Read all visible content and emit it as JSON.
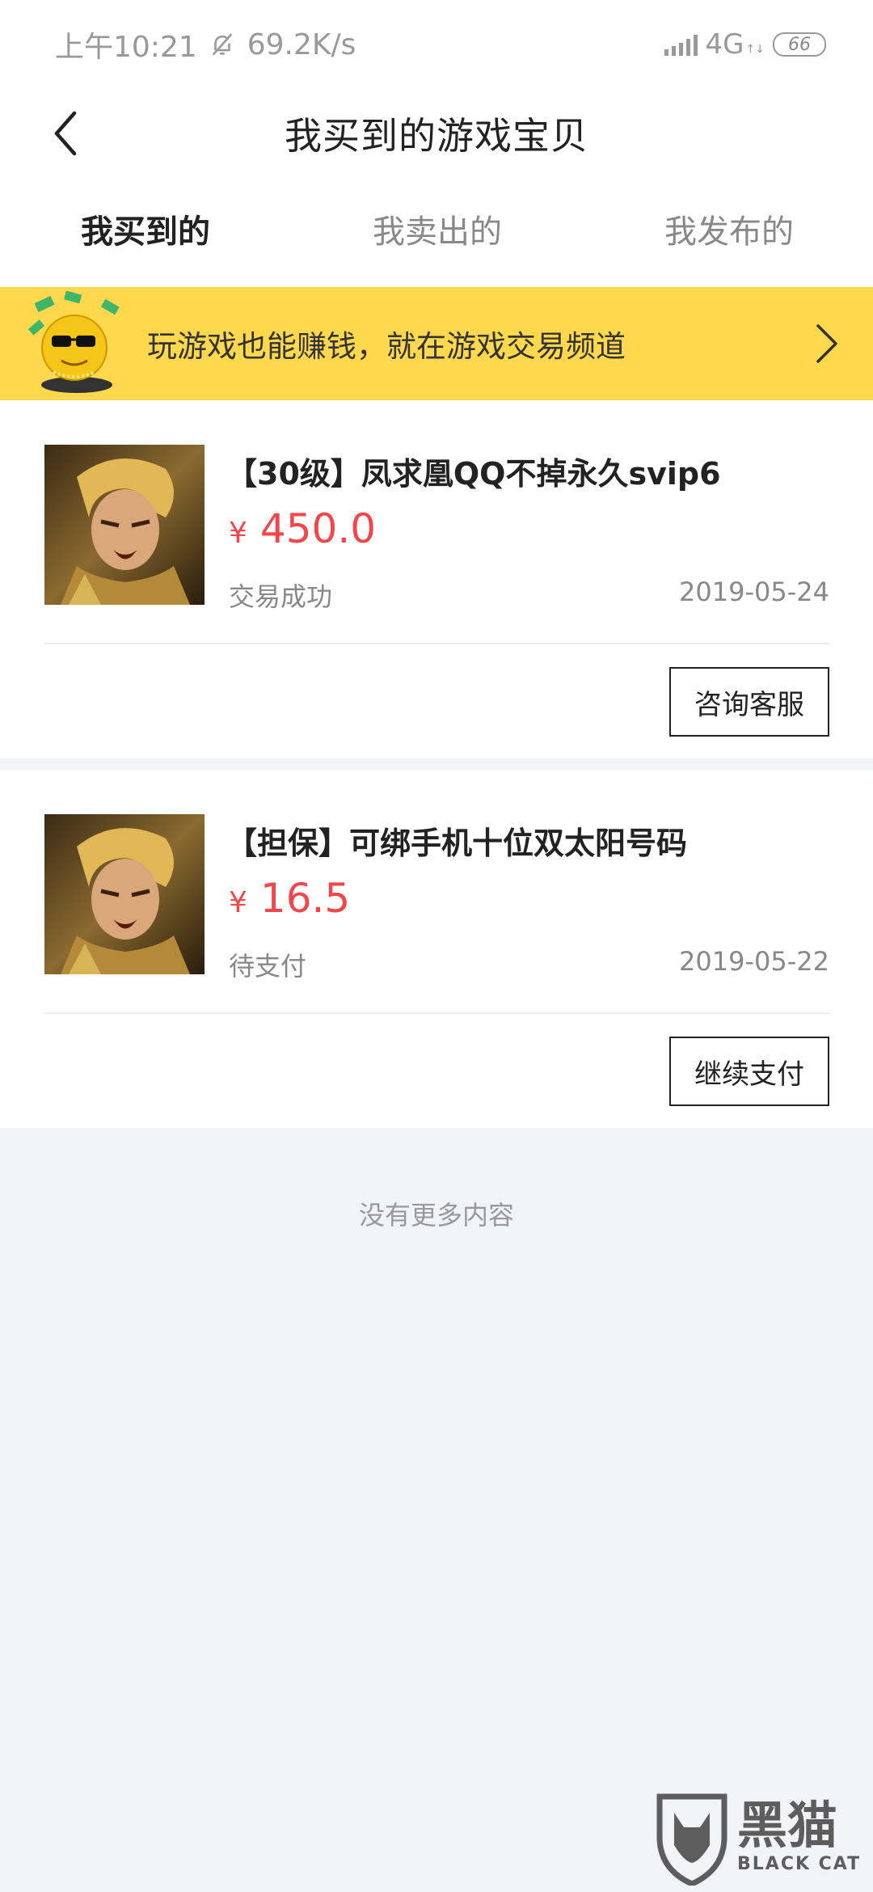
{
  "status_bar": {
    "time": "上午10:21",
    "speed": "69.2K/s",
    "network": "4G",
    "battery": "66"
  },
  "header": {
    "title": "我买到的游戏宝贝"
  },
  "tabs": [
    {
      "label": "我买到的",
      "active": true
    },
    {
      "label": "我卖出的",
      "active": false
    },
    {
      "label": "我发布的",
      "active": false
    }
  ],
  "banner": {
    "text": "玩游戏也能赚钱，就在游戏交易频道"
  },
  "orders": [
    {
      "title": "【30级】凤求凰QQ不掉永久svip6",
      "currency": "¥",
      "price": "450.0",
      "status": "交易成功",
      "date": "2019-05-24",
      "action": "咨询客服"
    },
    {
      "title": "【担保】可绑手机十位双太阳号码",
      "currency": "¥",
      "price": "16.5",
      "status": "待支付",
      "date": "2019-05-22",
      "action": "继续支付"
    }
  ],
  "footer": {
    "no_more": "没有更多内容"
  },
  "watermark": {
    "cn": "黑猫",
    "en": "BLACK CAT"
  },
  "colors": {
    "accent_yellow": "#ffd84d",
    "price_red": "#f2474a",
    "background": "#f2f3f7"
  }
}
